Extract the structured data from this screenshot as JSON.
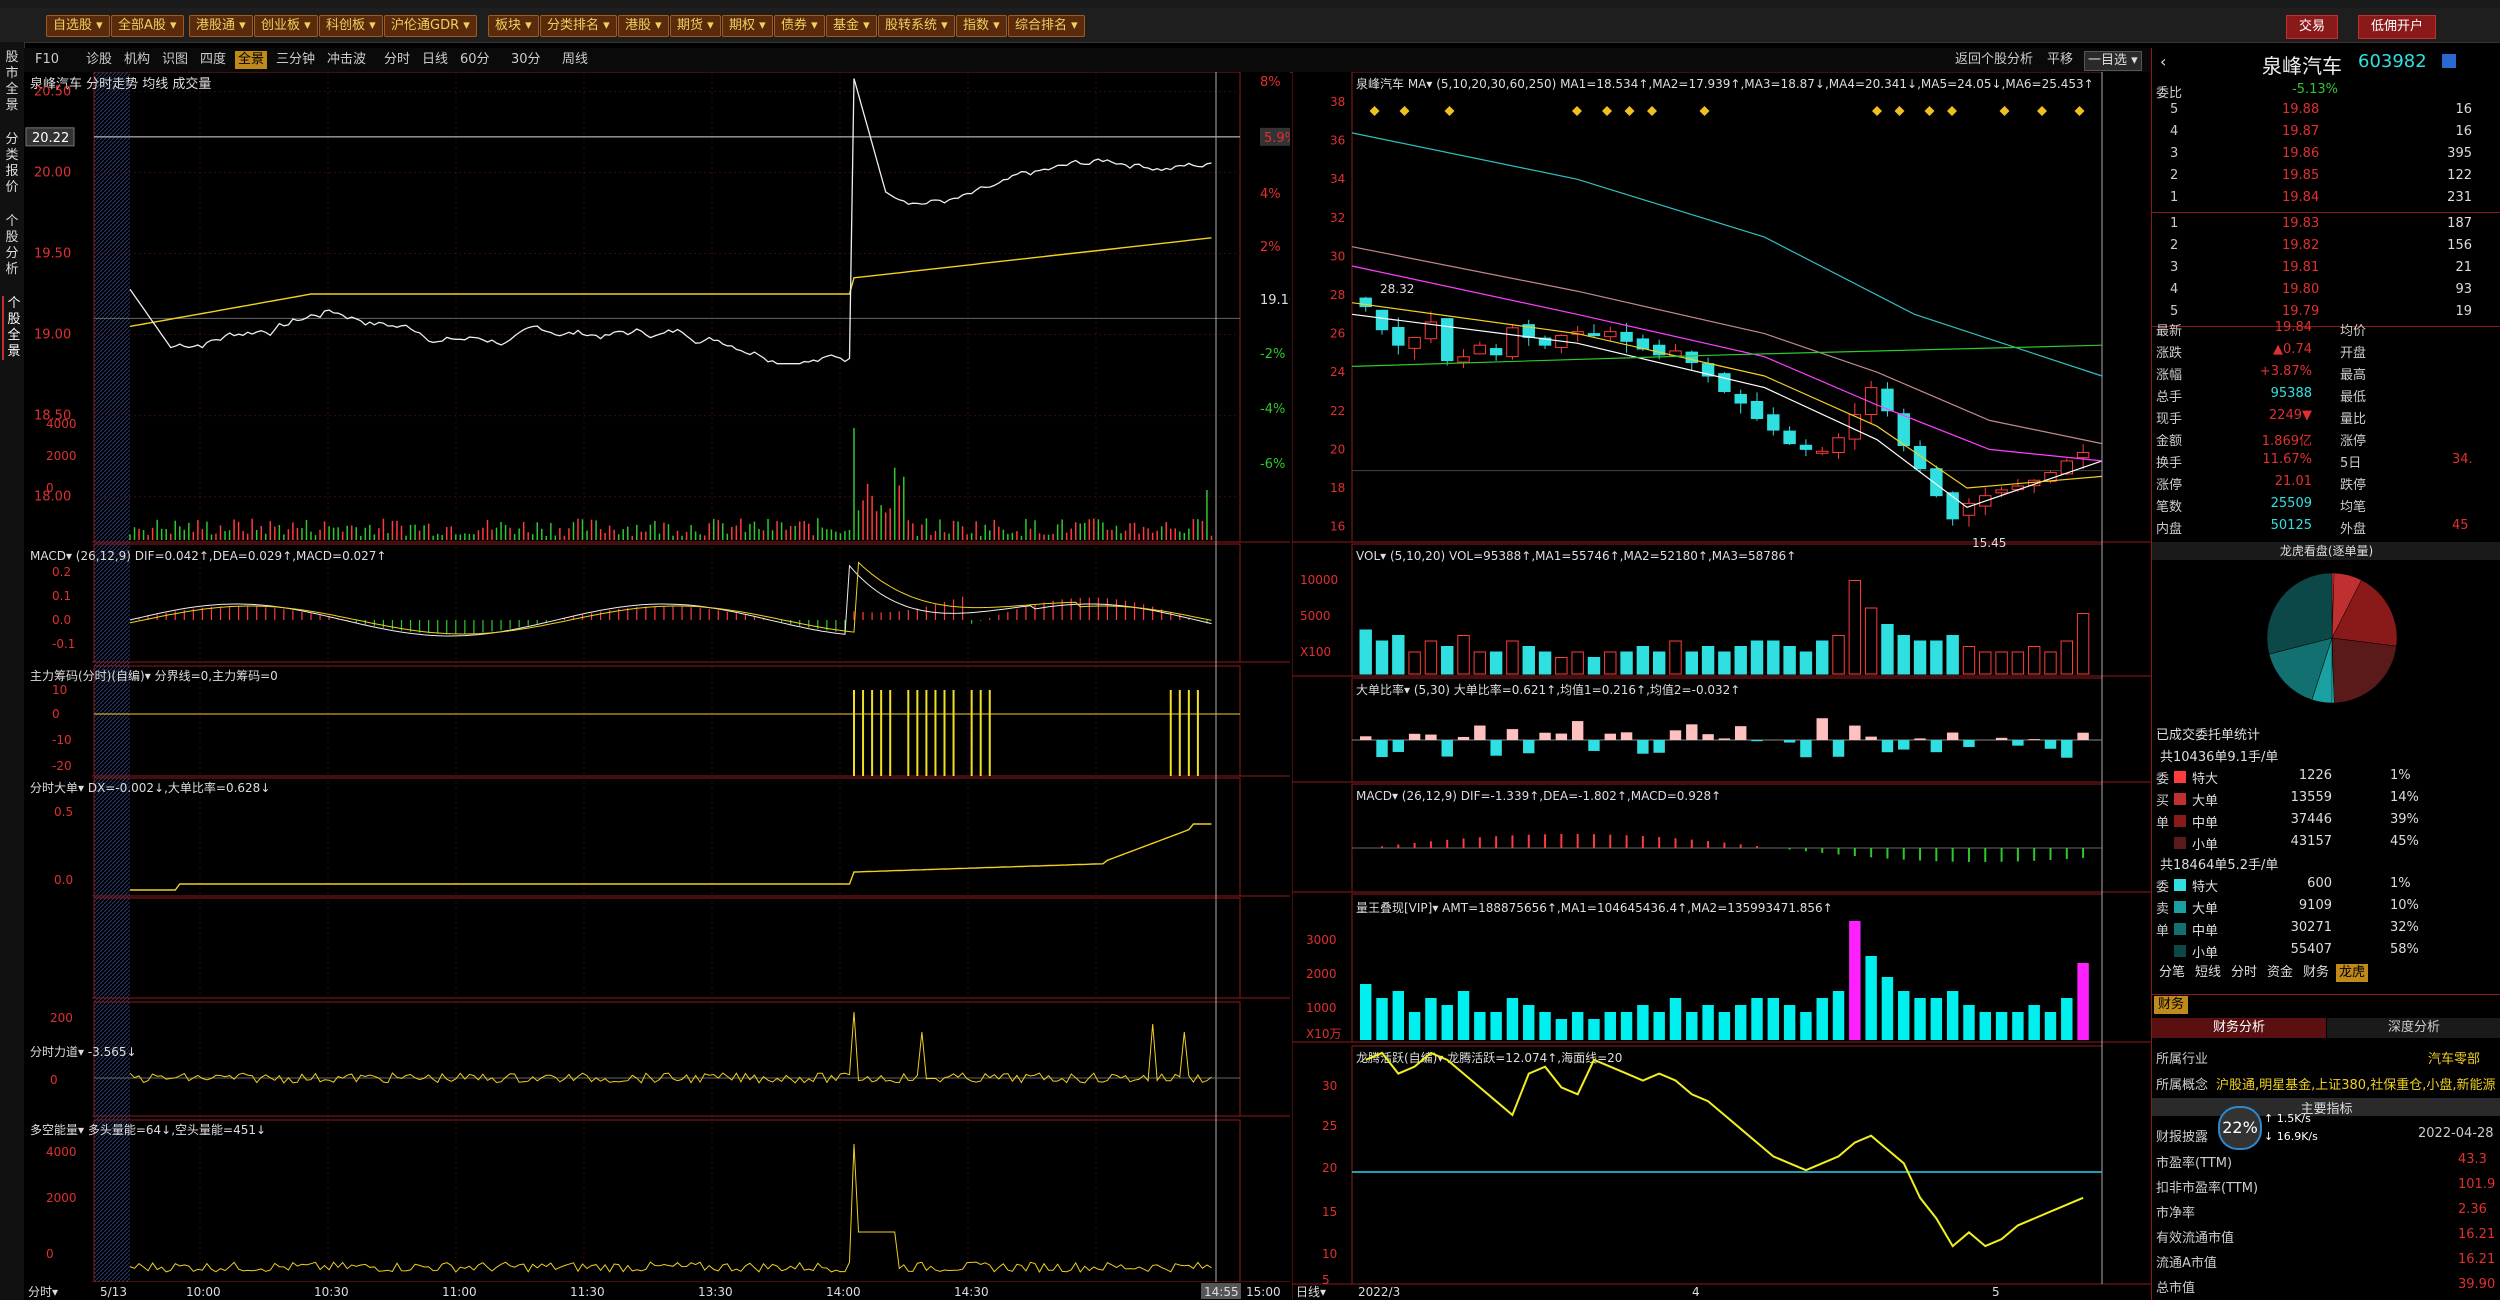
{
  "toolbar": {
    "buttons": [
      "自选股",
      "全部A股",
      "港股通",
      "创业板",
      "科创板",
      "沪伦通GDR",
      "板块",
      "分类排名",
      "港股",
      "期货",
      "期权",
      "债券",
      "基金",
      "股转系统",
      "指数",
      "综合排名"
    ],
    "trade_button": "交易",
    "open_account_button": "低佣开户"
  },
  "left_tabs": [
    "股市全景",
    "分类报价",
    "个股分析",
    "个股全景"
  ],
  "nav": {
    "items": [
      "F10",
      "诊股",
      "机构",
      "识图",
      "四度",
      "全景",
      "三分钟",
      "冲击波",
      "分时",
      "日线",
      "60分",
      "30分",
      "周线"
    ],
    "right_items": [
      "返回个股分析",
      "平移",
      "一目选"
    ]
  },
  "intraday": {
    "header": "泉峰汽车  分时走势 均线 成交量",
    "price_labels": [
      "20.50",
      "20.00",
      "19.50",
      "19.00",
      "18.50",
      "18.00"
    ],
    "pct_labels": [
      "8%",
      "6%",
      "4%",
      "2%",
      "19.10",
      "-2%",
      "-4%",
      "-6%"
    ],
    "cursor_price": "20.22",
    "cursor_pct": "5.9%",
    "vol_labels": [
      "4000",
      "2000",
      "0"
    ],
    "macd_title": "MACD▾ (26,12,9) DIF=0.042↑,DEA=0.029↑,MACD=0.027↑",
    "macd_labels": [
      "0.2",
      "0.1",
      "0.0",
      "-0.1"
    ],
    "chip_title": "主力筹码(分时)(自编)▾ 分界线=0,主力筹码=0",
    "chip_labels": [
      "10",
      "0",
      "-10",
      "-20"
    ],
    "bigorder_title": "分时大单▾ DX=-0.002↓,大单比率=0.628↓",
    "bigorder_labels": [
      "0.5",
      "0.0"
    ],
    "force_title": "分时力道▾ -3.565↓",
    "force_labels": [
      "200",
      "0"
    ],
    "energy_title": "多空能量▾ 多头量能=64↓,空头量能=451↓",
    "energy_labels": [
      "4000",
      "2000",
      "0"
    ],
    "time_labels": [
      "5/13",
      "10:00",
      "10:30",
      "11:00",
      "11:30",
      "13:30",
      "14:00",
      "14:30",
      "14:55",
      "15:00"
    ],
    "footer_left": "分时▾"
  },
  "kline": {
    "header": "泉峰汽车  MA▾ (5,10,20,30,60,250) MA1=18.534↑,MA2=17.939↑,MA3=18.87↓,MA4=20.341↓,MA5=24.05↓,MA6=25.453↑",
    "price_labels": [
      "38",
      "36",
      "34",
      "32",
      "30",
      "28",
      "26",
      "24",
      "22",
      "20",
      "18",
      "16"
    ],
    "high_label": "28.32",
    "low_label": "15.45",
    "vol_title": "VOL▾ (5,10,20) VOL=95388↑,MA1=55746↑,MA2=52180↑,MA3=58786↑",
    "vol_labels": [
      "10000",
      "5000",
      "X100"
    ],
    "bigratio_title": "大单比率▾ (5,30) 大单比率=0.621↑,均值1=0.216↑,均值2=-0.032↑",
    "macd_title": "MACD▾ (26,12,9) DIF=-1.339↑,DEA=-1.802↑,MACD=0.928↑",
    "amt_title": "量王叠现[VIP]▾ AMT=188875656↑,MA1=104645436.4↑,MA2=135993471.856↑",
    "amt_labels": [
      "3000",
      "2000",
      "1000",
      "X10万"
    ],
    "dragon_title": "龙腾活跃(自编)▾ 龙腾活跃=12.074↑,海面线=20",
    "dragon_labels": [
      "30",
      "25",
      "20",
      "15",
      "10",
      "5"
    ],
    "date_labels": [
      "2022/3",
      "4",
      "5"
    ],
    "footer_left": "日线▾"
  },
  "side": {
    "name": "泉峰汽车",
    "code": "603982",
    "weibi_label": "委比",
    "weibi": "-5.13%",
    "asks": [
      [
        "5",
        "19.88",
        "16"
      ],
      [
        "4",
        "19.87",
        "16"
      ],
      [
        "3",
        "19.86",
        "395"
      ],
      [
        "2",
        "19.85",
        "122"
      ],
      [
        "1",
        "19.84",
        "231"
      ]
    ],
    "bids": [
      [
        "1",
        "19.83",
        "187"
      ],
      [
        "2",
        "19.82",
        "156"
      ],
      [
        "3",
        "19.81",
        "21"
      ],
      [
        "4",
        "19.80",
        "93"
      ],
      [
        "5",
        "19.79",
        "19"
      ]
    ],
    "stats": [
      [
        "最新",
        "19.84",
        "均价",
        ""
      ],
      [
        "涨跌",
        "▲0.74",
        "开盘",
        ""
      ],
      [
        "涨幅",
        "+3.87%",
        "最高",
        ""
      ],
      [
        "总手",
        "95388",
        "最低",
        ""
      ],
      [
        "现手",
        "2249▼",
        "量比",
        ""
      ],
      [
        "金额",
        "1.869亿",
        "涨停",
        ""
      ],
      [
        "换手",
        "11.67%",
        "5日",
        "34."
      ],
      [
        "涨停",
        "21.01",
        "跌停",
        ""
      ],
      [
        "笔数",
        "25509",
        "均笔",
        ""
      ],
      [
        "内盘",
        "50125",
        "外盘",
        "45"
      ]
    ],
    "pie_title": "龙虎看盘(逐单量)",
    "pie_caption": "已成交委托单统计",
    "buy_header": "共10436单9.1手/单",
    "buy_rows": [
      [
        "特大",
        "1226",
        "1%"
      ],
      [
        "大单",
        "13559",
        "14%"
      ],
      [
        "中单",
        "37446",
        "39%"
      ],
      [
        "小单",
        "43157",
        "45%"
      ]
    ],
    "sell_header": "共18464单5.2手/单",
    "sell_rows": [
      [
        "特大",
        "600",
        "1%"
      ],
      [
        "大单",
        "9109",
        "10%"
      ],
      [
        "中单",
        "30271",
        "32%"
      ],
      [
        "小单",
        "55407",
        "58%"
      ]
    ],
    "side_buy_chars": [
      "委",
      "买",
      "单"
    ],
    "side_sell_chars": [
      "委",
      "卖",
      "单"
    ],
    "tabs": [
      "分笔",
      "短线",
      "分时",
      "资金",
      "财务",
      "龙虎"
    ],
    "fin_tab": "财务",
    "fin_subtabs": [
      "财务分析",
      "深度分析"
    ],
    "industry_label": "所属行业",
    "industry": "汽车零部",
    "concept_label": "所属概念",
    "concept": "沪股通,明星基金,上证380,社保重仓,小盘,新能源",
    "indicator_title": "主要指标",
    "report_label": "财报披露",
    "report_date": "2022-04-28",
    "circle_pct": "22%",
    "net_up": "1.5K/s",
    "net_down": "16.9K/s",
    "metrics": [
      [
        "市盈率(TTM)",
        "43.3"
      ],
      [
        "扣非市盈率(TTM)",
        "101.9"
      ],
      [
        "市净率",
        "2.36"
      ],
      [
        "有效流通市值",
        "16.21"
      ],
      [
        "流通A市值",
        "16.21"
      ],
      [
        "总市值",
        "39.90"
      ]
    ]
  },
  "colors": {
    "up": "#ff3b3b",
    "down": "#30e0e0",
    "ma_yellow": "#f0d020",
    "border": "#8a1a1a",
    "accent": "#c08a1a"
  }
}
